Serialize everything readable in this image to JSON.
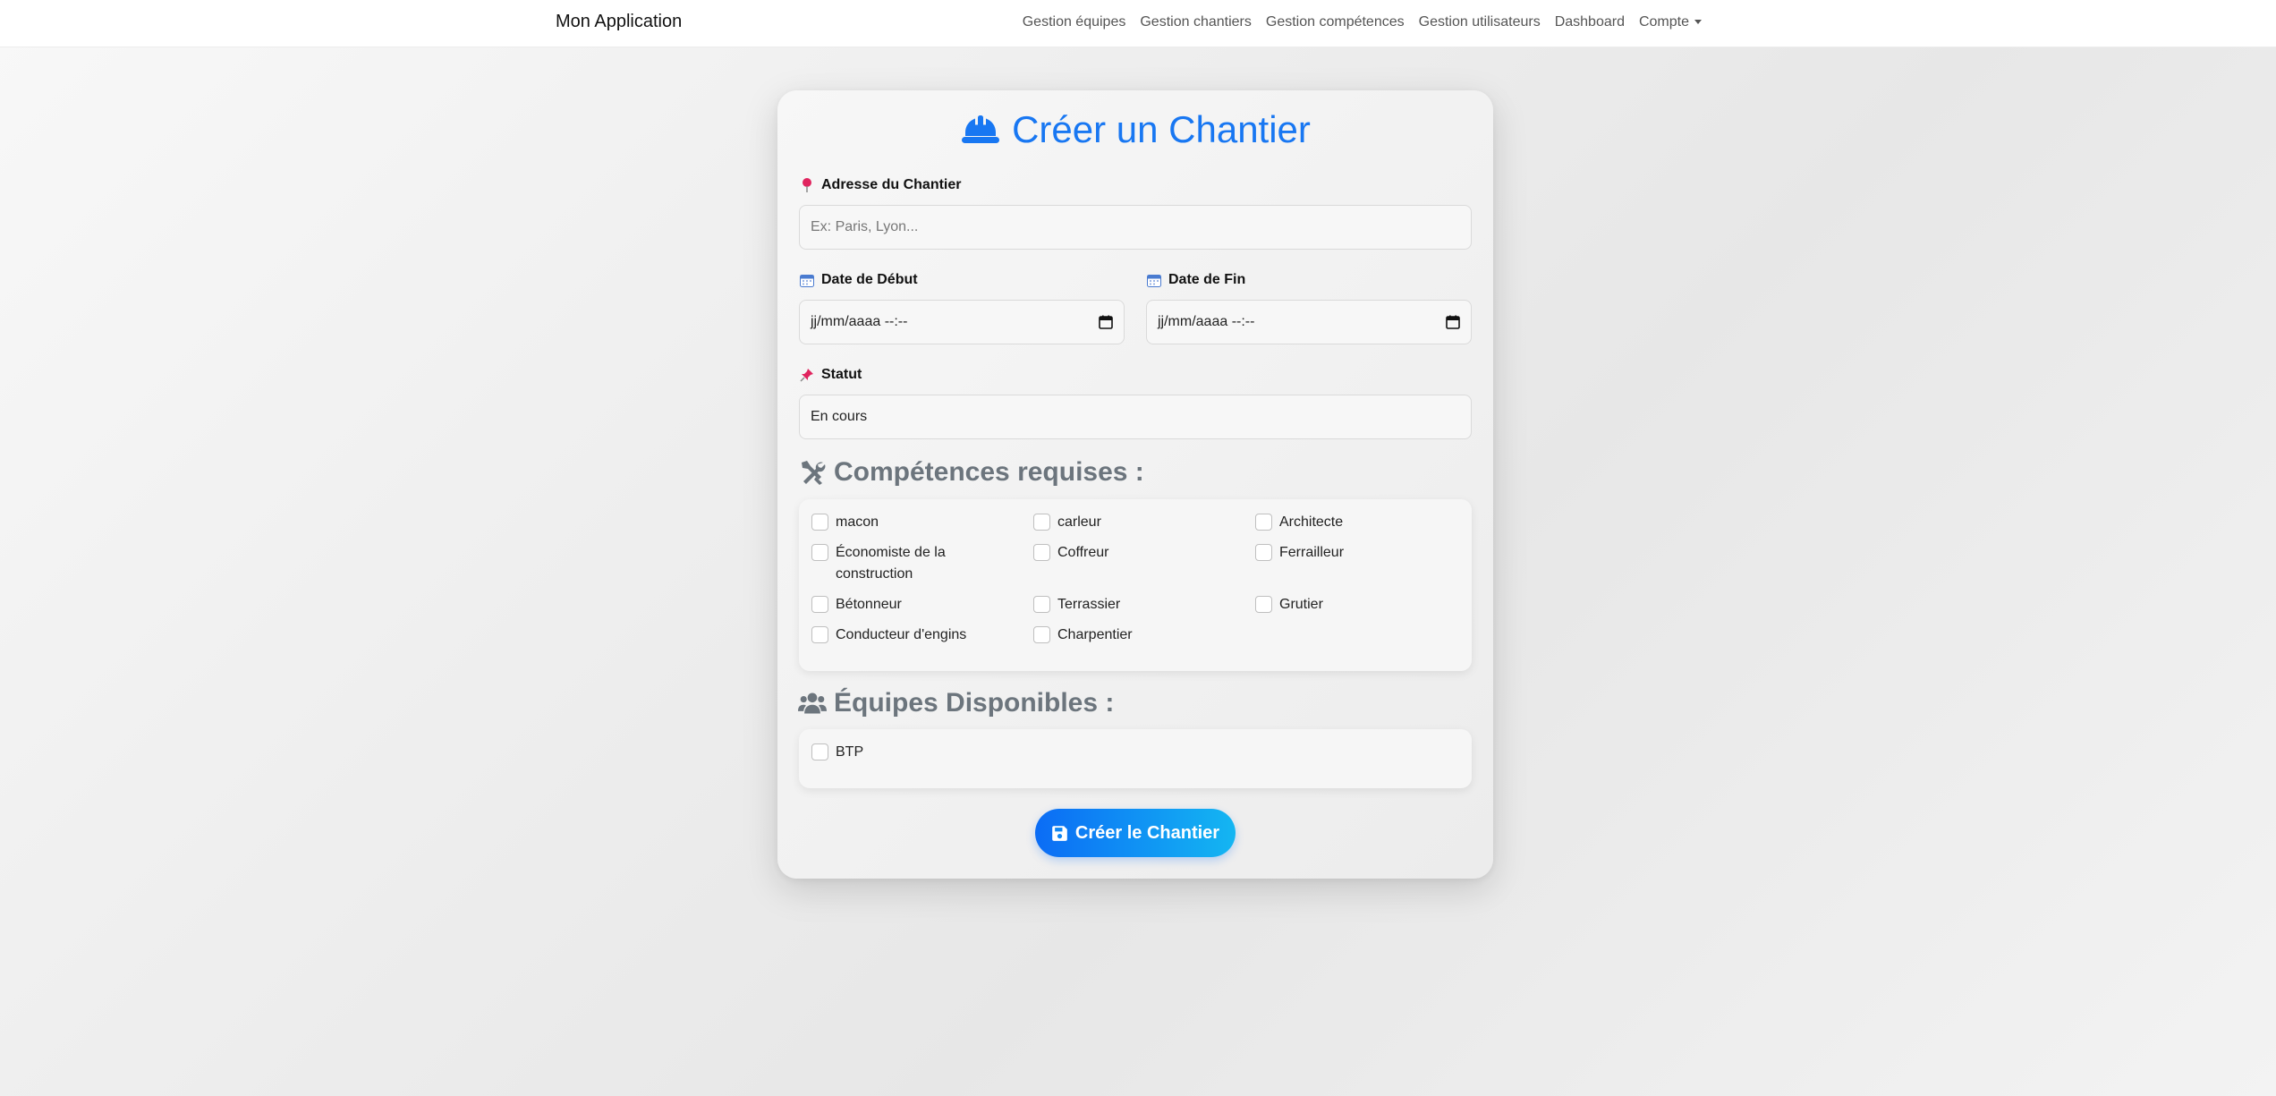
{
  "navbar": {
    "brand": "Mon Application",
    "links": [
      "Gestion équipes",
      "Gestion chantiers",
      "Gestion compétences",
      "Gestion utilisateurs",
      "Dashboard"
    ],
    "account_label": "Compte"
  },
  "form": {
    "title": "Créer un Chantier",
    "title_icon": "hard-hat-icon",
    "address": {
      "icon": "pin-icon",
      "label": "Adresse du Chantier",
      "placeholder": "Ex: Paris, Lyon...",
      "value": ""
    },
    "start_date": {
      "icon": "calendar-icon",
      "label": "Date de Début",
      "value": "jj/mm/aaaa --:--"
    },
    "end_date": {
      "icon": "calendar-icon",
      "label": "Date de Fin",
      "value": "jj/mm/aaaa --:--"
    },
    "status": {
      "icon": "pushpin-icon",
      "label": "Statut",
      "value": "En cours"
    },
    "skills": {
      "title": "Compétences requises :",
      "icon": "tools-icon",
      "items": [
        "macon",
        "carleur",
        "Architecte",
        "Économiste de la construction",
        "Coffreur",
        "Ferrailleur",
        "Bétonneur",
        "Terrassier",
        "Grutier",
        "Conducteur d'engins",
        "Charpentier"
      ]
    },
    "teams": {
      "title": "Équipes Disponibles :",
      "icon": "users-icon",
      "items": [
        "BTP"
      ]
    },
    "submit_label": "Créer le Chantier",
    "submit_icon": "save-icon"
  },
  "colors": {
    "accent": "#1877f2",
    "section_title": "#6c757d",
    "button_start": "#0b6cf5",
    "button_end": "#14b6f2"
  }
}
